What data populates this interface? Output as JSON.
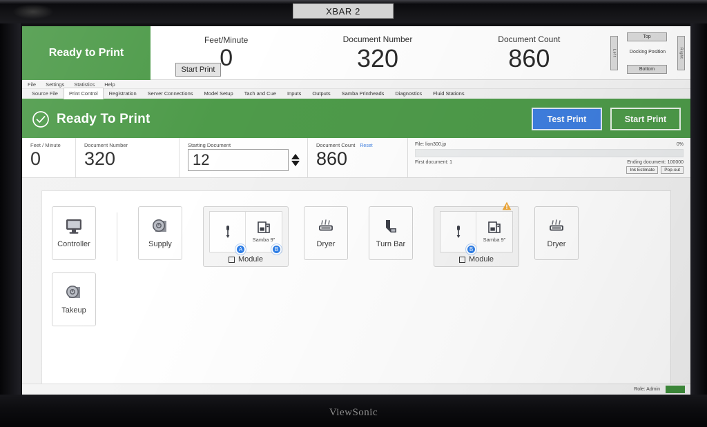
{
  "window": {
    "title": "XBAR 2",
    "monitor_brand": "ViewSonic"
  },
  "header": {
    "status_text": "Ready to Print",
    "start_print_label": "Start Print",
    "metrics": [
      {
        "label": "Feet/Minute",
        "value": "0"
      },
      {
        "label": "Document Number",
        "value": "320"
      },
      {
        "label": "Document Count",
        "value": "860"
      }
    ],
    "docking": {
      "title": "Docking Position",
      "top_label": "Top",
      "bottom_label": "Bottom",
      "left_label": "Left",
      "right_label": "Right"
    }
  },
  "menubar": {
    "items": [
      "File",
      "Settings",
      "Statistics",
      "Help"
    ]
  },
  "tabs": {
    "items": [
      "Source File",
      "Print Control",
      "Registration",
      "Server Connections",
      "Model Setup",
      "Tach and Cue",
      "Inputs",
      "Outputs",
      "Samba Printheads",
      "Diagnostics",
      "Fluid Stations"
    ],
    "active": "Print Control"
  },
  "banner": {
    "text": "Ready To Print",
    "test_print_label": "Test Print",
    "start_print_label": "Start Print",
    "color": "#4e9b4a",
    "test_button_color": "#3f7fe0"
  },
  "stats": {
    "feet_per_minute": {
      "label": "Feet / Minute",
      "value": "0"
    },
    "document_number": {
      "label": "Document Number",
      "value": "320"
    },
    "starting_document": {
      "label": "Starting Document",
      "value": "12"
    },
    "document_count": {
      "label": "Document Count",
      "value": "860",
      "reset_label": "Reset"
    }
  },
  "file_panel": {
    "file_label": "File: lion300.jp",
    "percent": "0%",
    "progress_value": 0,
    "first_document": "First document: 1",
    "ending_document": "Ending document: 100000",
    "ink_estimate_label": "Ink Estimate",
    "popout_label": "Pop-out"
  },
  "diagram": {
    "row1": [
      {
        "kind": "tile",
        "name": "controller",
        "label": "Controller",
        "icon": "monitor-icon"
      },
      {
        "kind": "divider"
      },
      {
        "kind": "tile",
        "name": "supply",
        "label": "Supply",
        "icon": "roll-icon"
      },
      {
        "kind": "module",
        "name": "module-a",
        "label": "Module",
        "cells": [
          {
            "label": "",
            "icon": "sensor-icon"
          },
          {
            "label": "Samba 9\"",
            "icon": "printhead-icon"
          }
        ],
        "badges": [
          "A",
          "B"
        ],
        "warning": false
      },
      {
        "kind": "tile",
        "name": "dryer-1",
        "label": "Dryer",
        "icon": "dryer-icon"
      },
      {
        "kind": "tile",
        "name": "turn-bar",
        "label": "Turn Bar",
        "icon": "turnbar-icon"
      },
      {
        "kind": "module",
        "name": "module-b",
        "label": "Module",
        "cells": [
          {
            "label": "",
            "icon": "sensor-icon"
          },
          {
            "label": "Samba 9\"",
            "icon": "printhead-icon"
          }
        ],
        "badges": [
          "B"
        ],
        "warning": true
      },
      {
        "kind": "tile",
        "name": "dryer-2",
        "label": "Dryer",
        "icon": "dryer-icon"
      }
    ],
    "row2": [
      {
        "kind": "tile",
        "name": "takeup",
        "label": "Takeup",
        "icon": "roll-icon"
      }
    ]
  },
  "statusbar": {
    "role": "Role: Admin"
  }
}
